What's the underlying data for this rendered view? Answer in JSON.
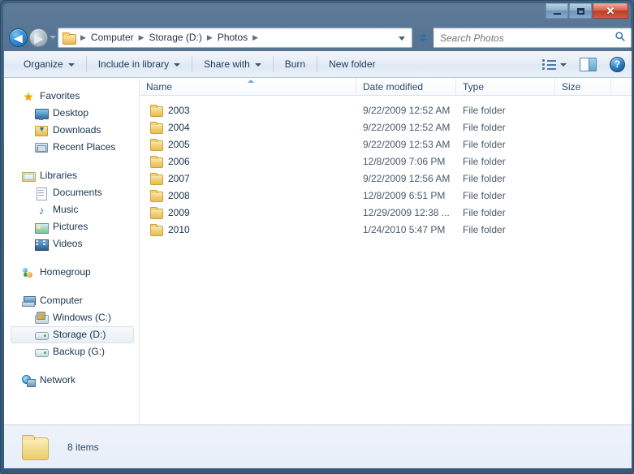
{
  "window": {
    "title": "",
    "controls": {
      "minimize": "–",
      "maximize": "□",
      "close": "✕"
    }
  },
  "navigation": {
    "back_label": "◀",
    "forward_label": "▶",
    "recent_dropdown": "",
    "refresh_label": "↻"
  },
  "breadcrumb": {
    "separator": "▶",
    "items": [
      "Computer",
      "Storage (D:)",
      "Photos"
    ]
  },
  "search": {
    "placeholder": "Search Photos",
    "value": "",
    "icon": "⌕"
  },
  "toolbar": {
    "items": [
      {
        "label": "Organize",
        "caret": true
      },
      {
        "label": "Include in library",
        "caret": true
      },
      {
        "label": "Share with",
        "caret": true
      },
      {
        "label": "Burn",
        "caret": false
      },
      {
        "label": "New folder",
        "caret": false
      }
    ],
    "view_icon": "view-options-icon",
    "preview_pane_icon": "preview-pane-icon",
    "help_label": "?"
  },
  "sidebar": {
    "groups": [
      {
        "header": {
          "label": "Favorites",
          "icon": "ic-star",
          "glyph": "★"
        },
        "items": [
          {
            "label": "Desktop",
            "icon": "ic-desktop"
          },
          {
            "label": "Downloads",
            "icon": "ic-download"
          },
          {
            "label": "Recent Places",
            "icon": "ic-recent"
          }
        ]
      },
      {
        "header": {
          "label": "Libraries",
          "icon": "ic-lib",
          "glyph": ""
        },
        "items": [
          {
            "label": "Documents",
            "icon": "ic-doc"
          },
          {
            "label": "Music",
            "icon": "ic-music",
            "glyph": "♪"
          },
          {
            "label": "Pictures",
            "icon": "ic-pic"
          },
          {
            "label": "Videos",
            "icon": "ic-vid"
          }
        ]
      },
      {
        "header": {
          "label": "Homegroup",
          "icon": "ic-home",
          "glyph": ""
        },
        "items": []
      },
      {
        "header": {
          "label": "Computer",
          "icon": "ic-comp",
          "glyph": ""
        },
        "items": [
          {
            "label": "Windows (C:)",
            "icon": "ic-drivec",
            "selected": false
          },
          {
            "label": "Storage (D:)",
            "icon": "ic-drive",
            "selected": true
          },
          {
            "label": "Backup (G:)",
            "icon": "ic-drive",
            "selected": false
          }
        ]
      },
      {
        "header": {
          "label": "Network",
          "icon": "ic-net",
          "glyph": ""
        },
        "items": []
      }
    ]
  },
  "columns": {
    "name": "Name",
    "date_modified": "Date modified",
    "type": "Type",
    "size": "Size",
    "sort_column": "Name",
    "sort_direction": "ascending"
  },
  "files": [
    {
      "name": "2003",
      "date": "9/22/2009 12:52 AM",
      "type": "File folder",
      "size": ""
    },
    {
      "name": "2004",
      "date": "9/22/2009 12:52 AM",
      "type": "File folder",
      "size": ""
    },
    {
      "name": "2005",
      "date": "9/22/2009 12:53 AM",
      "type": "File folder",
      "size": ""
    },
    {
      "name": "2006",
      "date": "12/8/2009 7:06 PM",
      "type": "File folder",
      "size": ""
    },
    {
      "name": "2007",
      "date": "9/22/2009 12:56 AM",
      "type": "File folder",
      "size": ""
    },
    {
      "name": "2008",
      "date": "12/8/2009 6:51 PM",
      "type": "File folder",
      "size": ""
    },
    {
      "name": "2009",
      "date": "12/29/2009 12:38 ...",
      "type": "File folder",
      "size": ""
    },
    {
      "name": "2010",
      "date": "1/24/2010 5:47 PM",
      "type": "File folder",
      "size": ""
    }
  ],
  "status": {
    "item_count_text": "8 items",
    "folder_icon": "folder-icon"
  },
  "colors": {
    "titlebar": "#3a5c7d",
    "close_button": "#bf3a26",
    "selection": "#eaf0f6",
    "folder_yellow": "#f3d179",
    "link_text": "#1c3c5c"
  }
}
